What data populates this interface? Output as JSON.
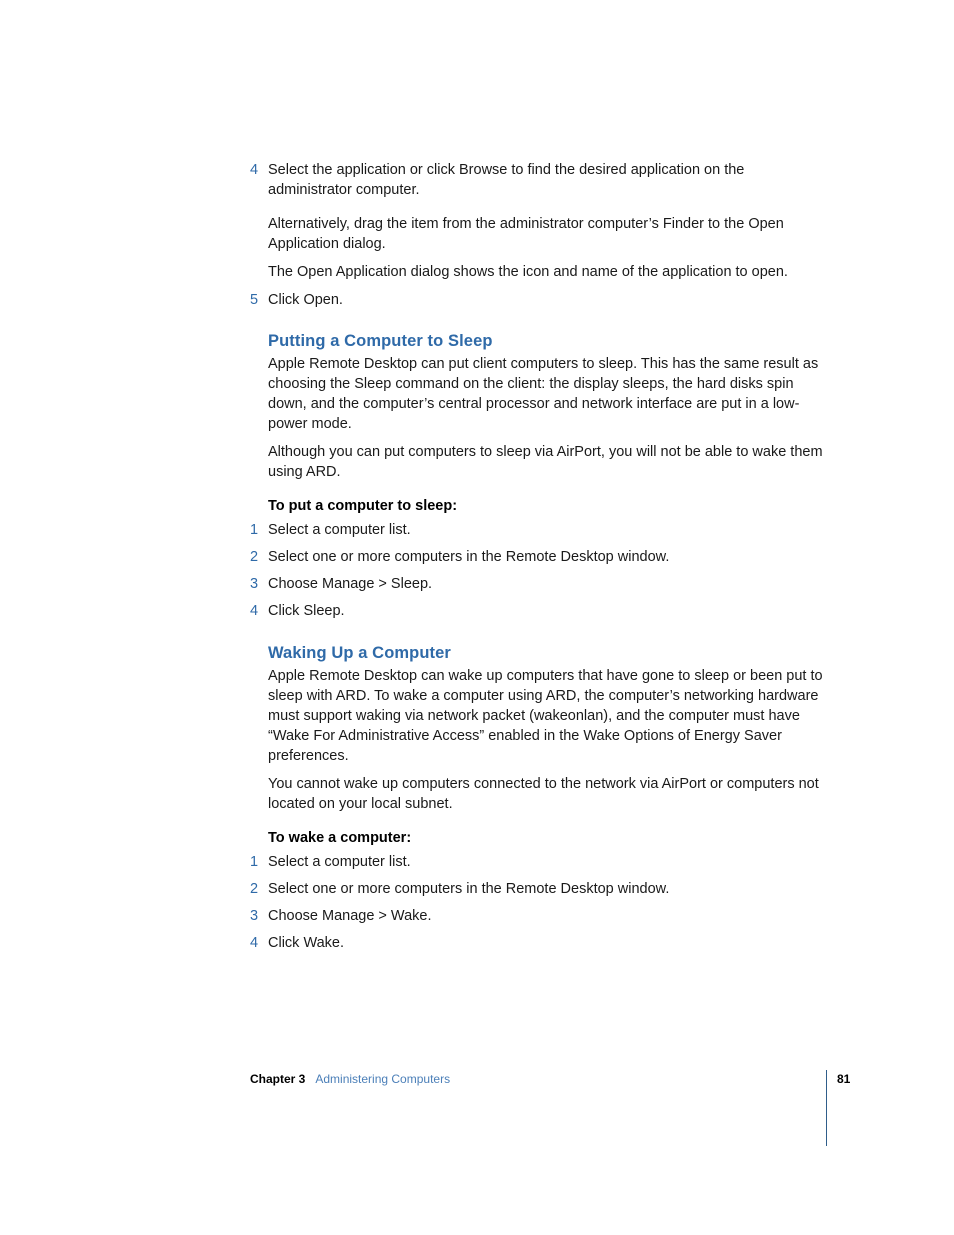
{
  "document": {
    "type": "manual-page",
    "colors": {
      "heading_blue": "#2f6aa8",
      "step_number_blue": "#2f6aa8",
      "footer_link_blue": "#4b7fb8",
      "footer_rule": "#2f5d8a",
      "body_text": "#1a1a1a",
      "background": "#ffffff"
    }
  },
  "top_steps": [
    {
      "number": "4",
      "text": "Select the application or click Browse to find the desired application on the administrator computer."
    },
    {
      "number": "5",
      "text": "Click Open."
    }
  ],
  "top_paragraphs": [
    "Alternatively, drag the item from the administrator computer’s Finder to the Open Application dialog.",
    "The Open Application dialog shows the icon and name of the application to open."
  ],
  "sleep_section": {
    "heading": "Putting a Computer to Sleep",
    "paragraphs": [
      "Apple Remote Desktop can put client computers to sleep. This has the same result as choosing the Sleep command on the client:  the display sleeps, the hard disks spin down, and the computer’s central processor and network interface are put in a low-power mode.",
      "Although you can put computers to sleep via AirPort, you will not be able to wake them using ARD."
    ],
    "subheading": "To put a computer to sleep:",
    "steps": [
      {
        "number": "1",
        "text": "Select a computer list."
      },
      {
        "number": "2",
        "text": "Select one or more computers in the Remote Desktop window."
      },
      {
        "number": "3",
        "text": "Choose Manage > Sleep."
      },
      {
        "number": "4",
        "text": "Click Sleep."
      }
    ]
  },
  "wake_section": {
    "heading": "Waking Up a Computer",
    "paragraphs": [
      "Apple Remote Desktop can wake up computers that have gone to sleep or been put to sleep with ARD. To wake a computer using ARD, the computer’s networking hardware must support waking via network packet (wakeonlan), and the computer must have “Wake For Administrative Access” enabled in the Wake Options of Energy Saver preferences.",
      "You cannot wake up computers connected to the network via AirPort or computers not located on your local subnet."
    ],
    "subheading": "To wake a computer:",
    "steps": [
      {
        "number": "1",
        "text": "Select a computer list."
      },
      {
        "number": "2",
        "text": "Select one or more computers in the Remote Desktop window."
      },
      {
        "number": "3",
        "text": "Choose Manage > Wake."
      },
      {
        "number": "4",
        "text": "Click Wake."
      }
    ]
  },
  "footer": {
    "chapter": "Chapter 3",
    "chapter_title": "Administering Computers",
    "page_number": "81"
  }
}
